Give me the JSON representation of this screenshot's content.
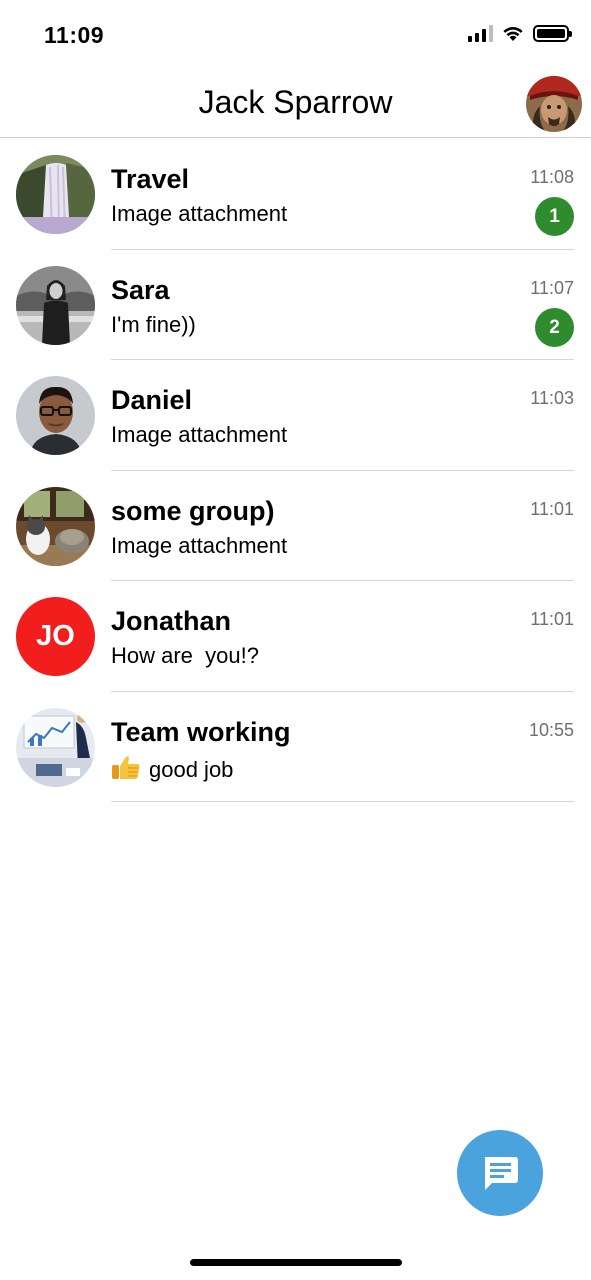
{
  "status_bar": {
    "time": "11:09",
    "icons": [
      "signal-icon",
      "wifi-icon",
      "battery-icon"
    ]
  },
  "header": {
    "title": "Jack Sparrow",
    "avatar_icon": "profile-avatar"
  },
  "chats": [
    {
      "name": "Travel",
      "preview": "Image attachment",
      "time": "11:08",
      "unread": "1",
      "avatar": "waterfall-photo"
    },
    {
      "name": "Sara",
      "preview": "I'm fine))",
      "time": "11:07",
      "unread": "2",
      "avatar": "woman-photo"
    },
    {
      "name": "Daniel",
      "preview": "Image attachment",
      "time": "11:03",
      "avatar": "man-glasses-photo"
    },
    {
      "name": "some group)",
      "preview": "Image attachment",
      "time": "11:01",
      "avatar": "cats-photo"
    },
    {
      "name": "Jonathan",
      "preview": "How are  you!?",
      "time": "11:01",
      "initials": "JO",
      "avatar": "initials-avatar"
    },
    {
      "name": "Team working",
      "preview": "good job",
      "time": "10:55",
      "avatar": "office-photo",
      "preview_icon": "thumbs-up-icon"
    }
  ],
  "fab": {
    "icon": "new-message-icon"
  },
  "colors": {
    "unread_badge": "#2e8b2e",
    "fab": "#4aa3dc",
    "initials_avatar": "#f21d1d",
    "time_text": "#6f6f6f"
  }
}
